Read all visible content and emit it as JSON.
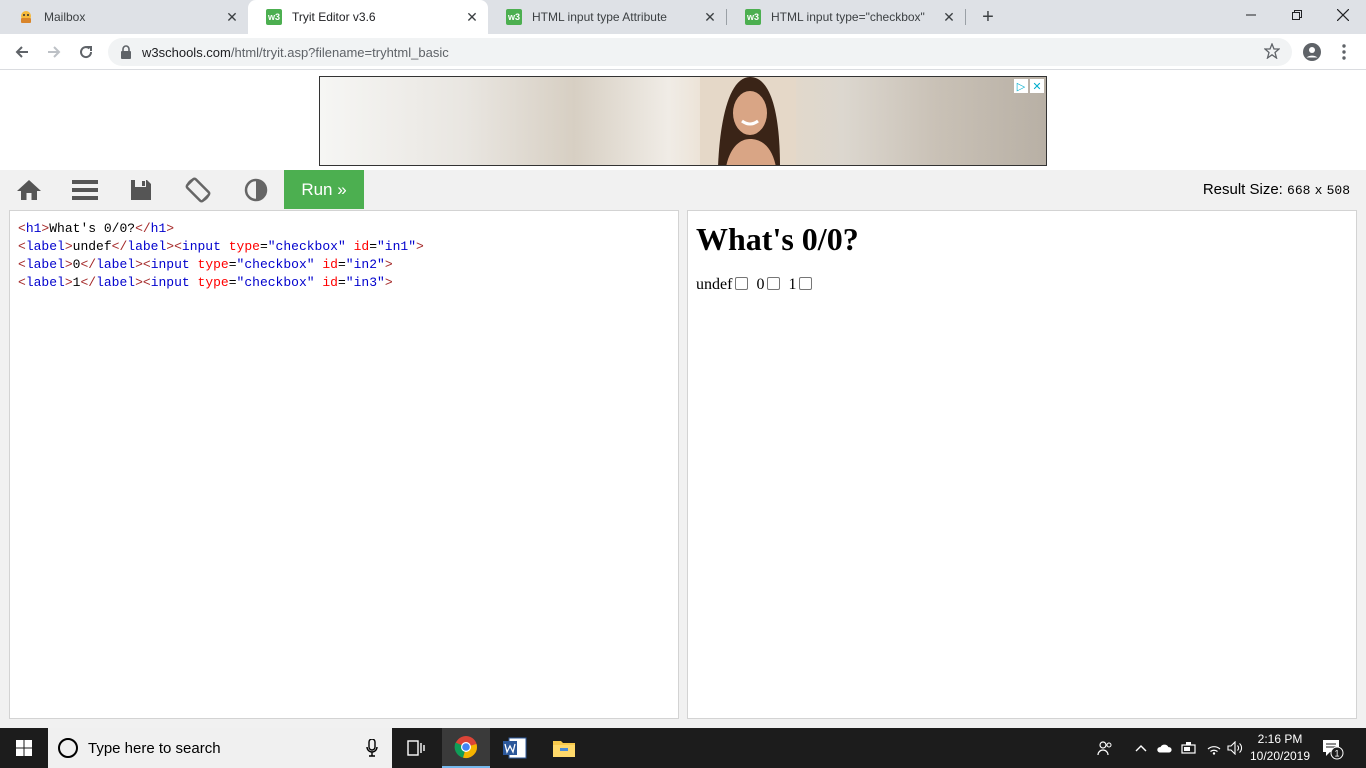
{
  "browser": {
    "tabs": [
      {
        "label": "Mailbox",
        "favicon": "mail-favicon",
        "active": false
      },
      {
        "label": "Tryit Editor v3.6",
        "favicon": "w3-favicon",
        "active": true
      },
      {
        "label": "HTML input type Attribute",
        "favicon": "w3-favicon",
        "active": false
      },
      {
        "label": "HTML input type=\"checkbox\"",
        "favicon": "w3-favicon",
        "active": false
      }
    ],
    "url_host": "w3schools.com",
    "url_path": "/html/tryit.asp?filename=tryhtml_basic"
  },
  "editor": {
    "run_label": "Run »",
    "result_size_label": "Result Size:",
    "result_width": "668",
    "result_x": "x",
    "result_height": "508",
    "toolbar_icons": [
      "home-icon",
      "menu-icon",
      "save-icon",
      "rotate-icon",
      "contrast-icon"
    ],
    "code": {
      "l1": {
        "t1": "<",
        "n1": "h1",
        "t2": ">",
        "text": "What's 0/0?",
        "t3": "</",
        "n2": "h1",
        "t4": ">"
      },
      "lines": [
        {
          "label": "undef",
          "id": "\"in1\""
        },
        {
          "label": "0",
          "id": "\"in2\""
        },
        {
          "label": "1",
          "id": "\"in3\""
        }
      ],
      "type_attr": "type",
      "type_val": "\"checkbox\"",
      "id_attr": "id",
      "eq": "="
    }
  },
  "result": {
    "heading": "What's 0/0?",
    "checkboxes": [
      {
        "label": "undef",
        "checked": false
      },
      {
        "label": "0",
        "checked": false
      },
      {
        "label": "1",
        "checked": false
      }
    ]
  },
  "taskbar": {
    "search_placeholder": "Type here to search",
    "time": "2:16 PM",
    "date": "10/20/2019",
    "notification_count": "1"
  },
  "colors": {
    "w3_green": "#4CAF50",
    "tab_strip": "#dee1e6",
    "taskbar": "#1c1c1c"
  }
}
